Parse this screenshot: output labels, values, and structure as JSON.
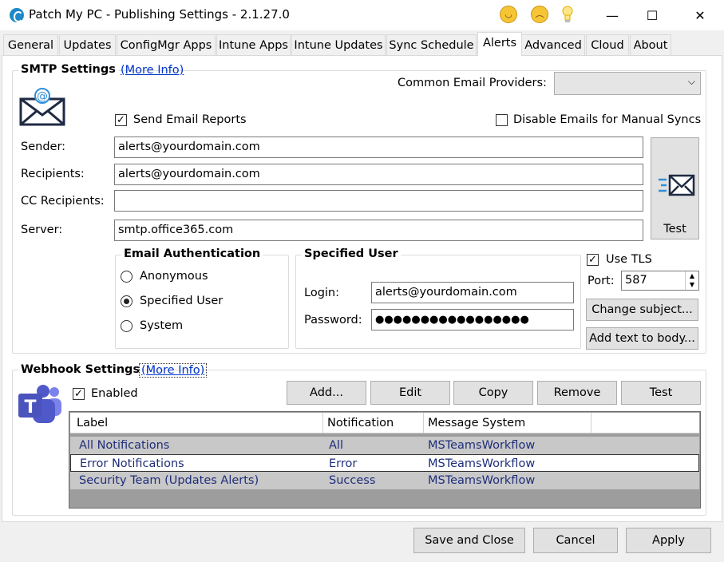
{
  "window": {
    "title": "Patch My PC - Publishing Settings - 2.1.27.0",
    "icons": [
      "app-logo-icon",
      "happy-face-icon",
      "sad-face-icon",
      "lightbulb-icon"
    ],
    "controls": {
      "minimize": "—",
      "maximize": "☐",
      "close": "✕"
    }
  },
  "tabs": [
    {
      "label": "General"
    },
    {
      "label": "Updates"
    },
    {
      "label": "ConfigMgr Apps"
    },
    {
      "label": "Intune Apps"
    },
    {
      "label": "Intune Updates"
    },
    {
      "label": "Sync Schedule"
    },
    {
      "label": "Alerts",
      "active": true
    },
    {
      "label": "Advanced"
    },
    {
      "label": "Cloud"
    },
    {
      "label": "About"
    }
  ],
  "smtp": {
    "title": "SMTP Settings",
    "more_info": "(More Info)",
    "common_providers_label": "Common Email Providers:",
    "common_providers_value": "",
    "send_reports_label": "Send Email Reports",
    "send_reports_checked": true,
    "disable_manual_label": "Disable Emails for Manual Syncs",
    "disable_manual_checked": false,
    "sender_label": "Sender:",
    "sender_value": "alerts@yourdomain.com",
    "recipients_label": "Recipients:",
    "recipients_value": "alerts@yourdomain.com",
    "cc_label": "CC Recipients:",
    "cc_value": "",
    "server_label": "Server:",
    "server_value": "smtp.office365.com",
    "test_label": "Test",
    "auth": {
      "title": "Email Authentication",
      "options": [
        "Anonymous",
        "Specified User",
        "System"
      ],
      "selected": "Specified User"
    },
    "specified_user": {
      "title": "Specified User",
      "login_label": "Login:",
      "login_value": "alerts@yourdomain.com",
      "password_label": "Password:",
      "password_value": "●●●●●●●●●●●●●●●●●"
    },
    "use_tls_label": "Use TLS",
    "use_tls_checked": true,
    "port_label": "Port:",
    "port_value": "587",
    "change_subject_label": "Change subject...",
    "add_text_label": "Add text to body..."
  },
  "webhook": {
    "title": "Webhook Settings",
    "more_info": "(More Info)",
    "enabled_label": "Enabled",
    "enabled_checked": true,
    "buttons": {
      "add": "Add...",
      "edit": "Edit",
      "copy": "Copy",
      "remove": "Remove",
      "test": "Test"
    },
    "columns": [
      "Label",
      "Notification Level",
      "Message System"
    ],
    "rows": [
      {
        "label": "All Notifications",
        "level": "All",
        "system": "MSTeamsWorkflow"
      },
      {
        "label": "Error Notifications",
        "level": "Error",
        "system": "MSTeamsWorkflow"
      },
      {
        "label": "Security Team (Updates Alerts)",
        "level": "Success",
        "system": "MSTeamsWorkflow"
      }
    ]
  },
  "footer": {
    "save_close": "Save and Close",
    "cancel": "Cancel",
    "apply": "Apply"
  }
}
